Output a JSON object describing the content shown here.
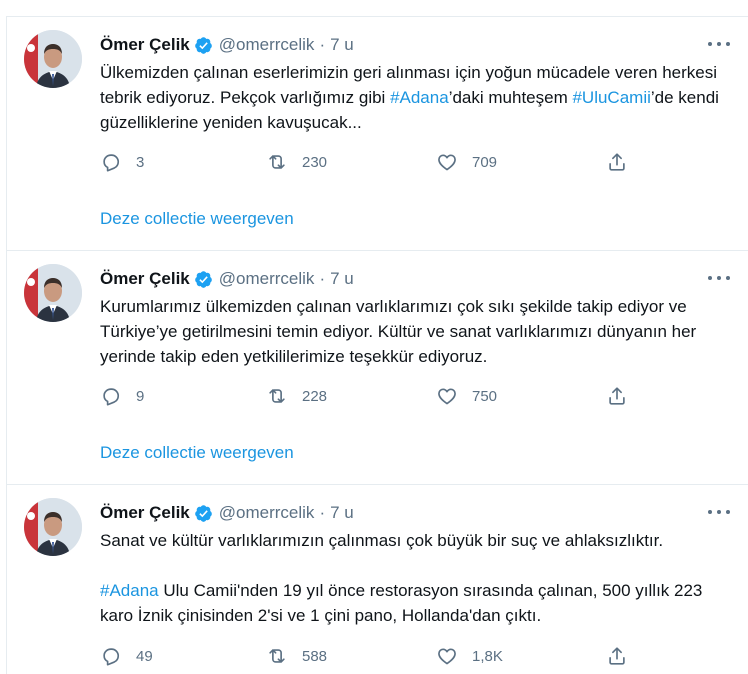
{
  "colors": {
    "link": "#1b95e0",
    "verified": "#1da1f2",
    "muted": "#5b7083",
    "text": "#0f1419"
  },
  "icons": [
    "verified-badge-icon",
    "more-icon",
    "reply-icon",
    "retweet-icon",
    "like-icon",
    "share-icon"
  ],
  "tweets": [
    {
      "name": "Ömer Çelik",
      "handle": "@omerrcelik",
      "separator": "·",
      "time": "7 u",
      "text1": "Ülkemizden çalınan eserlerimizin geri alınması için yoğun mücadele veren herkesi tebrik ediyoruz. Pekçok varlığımız gibi ",
      "hashtag1": "#Adana",
      "text2": "’daki muhteşem ",
      "hashtag2": "#UluCamii",
      "text3": "’de kendi güzelliklerine yeniden kavuşucak...",
      "replies": "3",
      "retweets": "230",
      "likes": "709",
      "collection": "Deze collectie weergeven"
    },
    {
      "name": "Ömer Çelik",
      "handle": "@omerrcelik",
      "separator": "·",
      "time": "7 u",
      "text": "Kurumlarımız ülkemizden çalınan varlıklarımızı çok sıkı şekilde takip ediyor ve Türkiye’ye getirilmesini temin ediyor. Kültür ve sanat varlıklarımızı dünyanın her yerinde takip eden yetkililerimize teşekkür ediyoruz.",
      "replies": "9",
      "retweets": "228",
      "likes": "750",
      "collection": "Deze collectie weergeven"
    },
    {
      "name": "Ömer Çelik",
      "handle": "@omerrcelik",
      "separator": "·",
      "time": "7 u",
      "para1": "Sanat ve kültür varlıklarımızın çalınması çok büyük bir suç ve ahlaksızlıktır.",
      "hashtag": "#Adana",
      "para2": " Ulu Camii'nden 19 yıl önce restorasyon sırasında çalınan, 500 yıllık 223 karo İznik çinisinden 2'si ve 1 çini pano, Hollanda'dan çıktı.",
      "replies": "49",
      "retweets": "588",
      "likes": "1,8K"
    }
  ]
}
